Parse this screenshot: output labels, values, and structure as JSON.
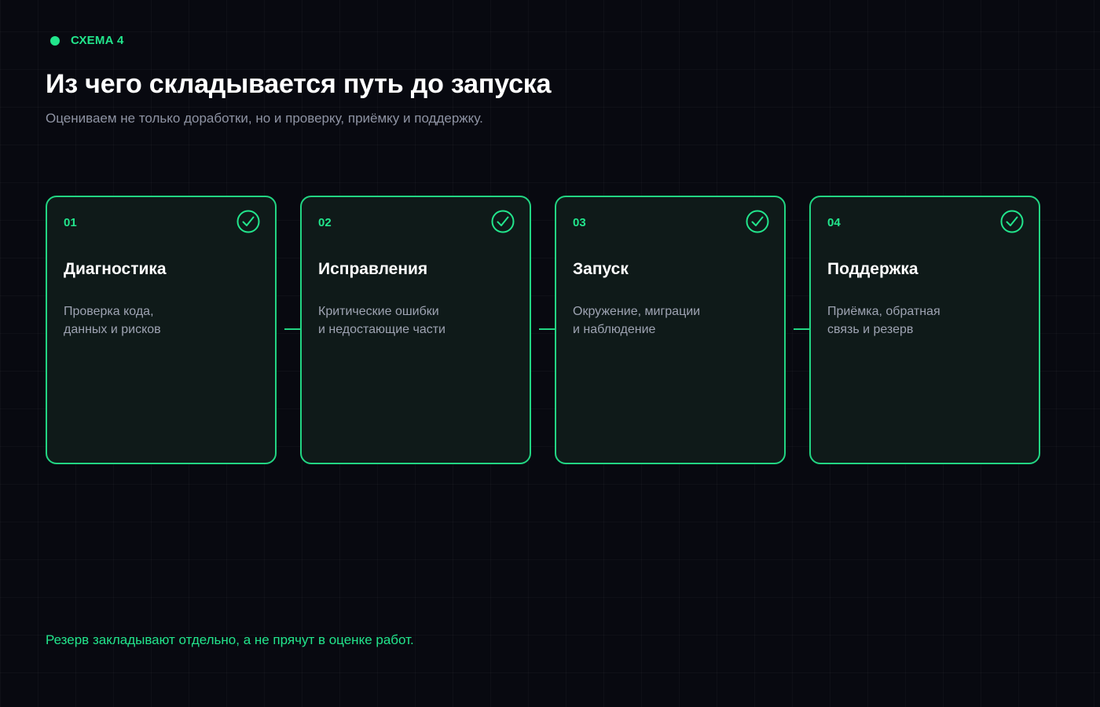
{
  "eyebrow": {
    "label": "СХЕМА 4",
    "dot_color": "#22e58c"
  },
  "title": "Из чего складывается путь до запуска",
  "subtitle": "Оцениваем не только доработки, но и проверку, приёмку и поддержку.",
  "steps": [
    {
      "number": "01",
      "title": "Диагностика",
      "desc_line1": "Проверка кода,",
      "desc_line2": "данных и рисков",
      "icon": "check-circle-icon"
    },
    {
      "number": "02",
      "title": "Исправления",
      "desc_line1": "Критические ошибки",
      "desc_line2": "и недостающие части",
      "icon": "check-circle-icon"
    },
    {
      "number": "03",
      "title": "Запуск",
      "desc_line1": "Окружение, миграции",
      "desc_line2": "и наблюдение",
      "icon": "check-circle-icon"
    },
    {
      "number": "04",
      "title": "Поддержка",
      "desc_line1": "Приёмка, обратная",
      "desc_line2": "связь и резерв",
      "icon": "check-circle-icon"
    }
  ],
  "footnote": "Резерв закладывают отдельно, а не прячут в оценке работ.",
  "colors": {
    "accent": "#22e58c",
    "card_border": "#22d583",
    "card_bg": "#0f1a19",
    "page_bg": "#080910"
  }
}
